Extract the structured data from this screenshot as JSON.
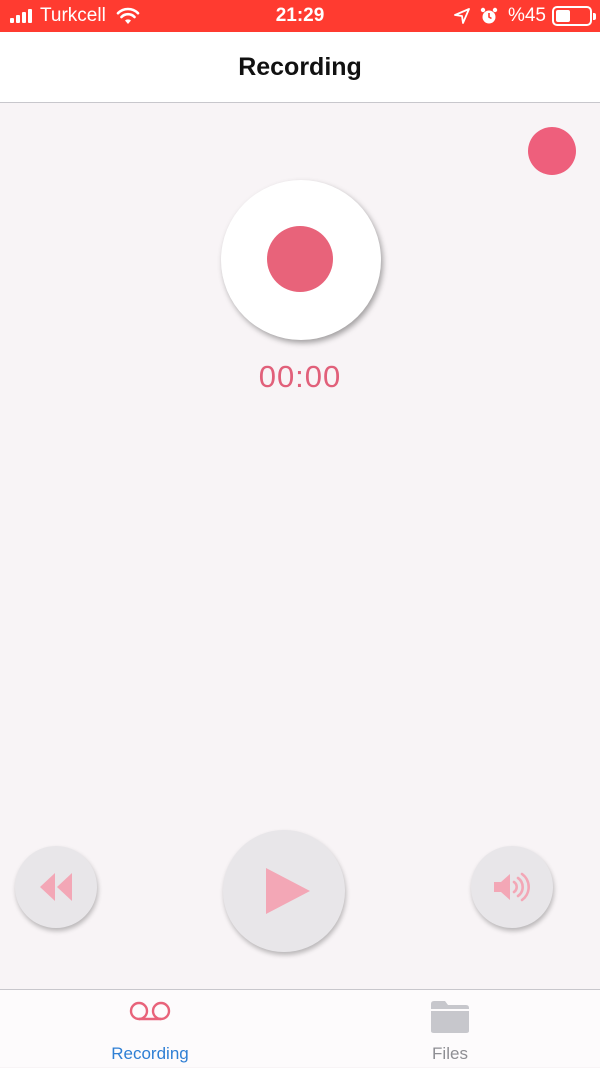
{
  "status_bar": {
    "carrier": "Turkcell",
    "time": "21:29",
    "battery_text": "%45",
    "battery_level": 0.45,
    "icons": [
      "signal-icon",
      "wifi-icon",
      "location-arrow-icon",
      "alarm-icon",
      "battery-icon"
    ]
  },
  "nav": {
    "title": "Recording"
  },
  "recorder": {
    "timer": "00:00",
    "state": "idle"
  },
  "playback": {
    "controls": [
      "rewind-icon",
      "play-icon",
      "speaker-icon"
    ]
  },
  "tabs": [
    {
      "label": "Recording",
      "icon": "voicemail-icon",
      "active": true
    },
    {
      "label": "Files",
      "icon": "folder-icon",
      "active": false
    }
  ],
  "colors": {
    "status_bar": "#ff3b30",
    "accent": "#e8637a",
    "tab_active": "#2f7fd4",
    "tab_inactive": "#8e8e93",
    "control_bg": "#e8e6e9",
    "background": "#f8f4f6"
  }
}
